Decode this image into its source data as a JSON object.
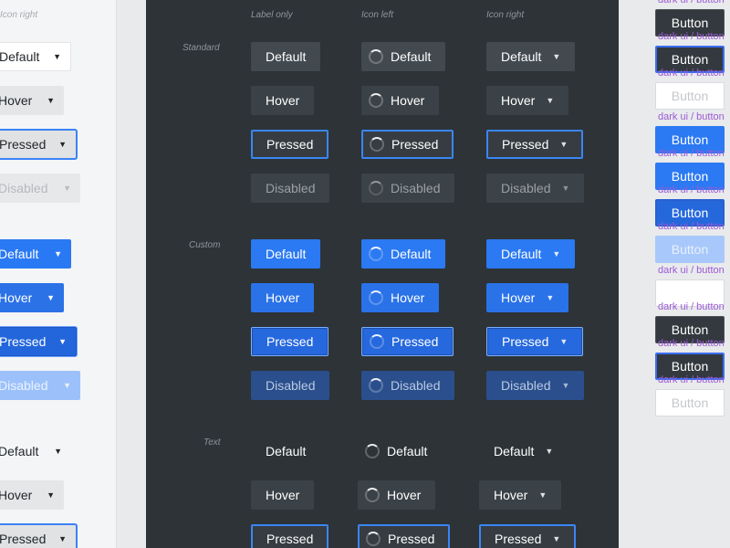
{
  "left": {
    "column_title": "Icon right",
    "buttons": {
      "standard_default": "Default",
      "standard_hover": "Hover",
      "standard_pressed": "Pressed",
      "standard_disabled": "Disabled",
      "custom_default": "Default",
      "custom_hover": "Hover",
      "custom_pressed": "Pressed",
      "custom_disabled": "Disabled",
      "text_default": "Default",
      "text_hover": "Hover",
      "text_pressed": "Pressed"
    }
  },
  "dark": {
    "columns": [
      "Label only",
      "Icon left",
      "Icon right"
    ],
    "rows": [
      "Standard",
      "Custom",
      "Text"
    ],
    "states": [
      "Default",
      "Hover",
      "Pressed",
      "Disabled"
    ],
    "chevron_icon": "chevron-down-icon",
    "spinner_icon": "spinner-icon"
  },
  "right": {
    "button_label": "Button",
    "component_label": "dark ui / button"
  },
  "colors": {
    "accent": "#2b79f3",
    "dark_bg": "#2d3337",
    "focus_ring": "#3a86f5",
    "component_label": "#9b5ad6"
  }
}
